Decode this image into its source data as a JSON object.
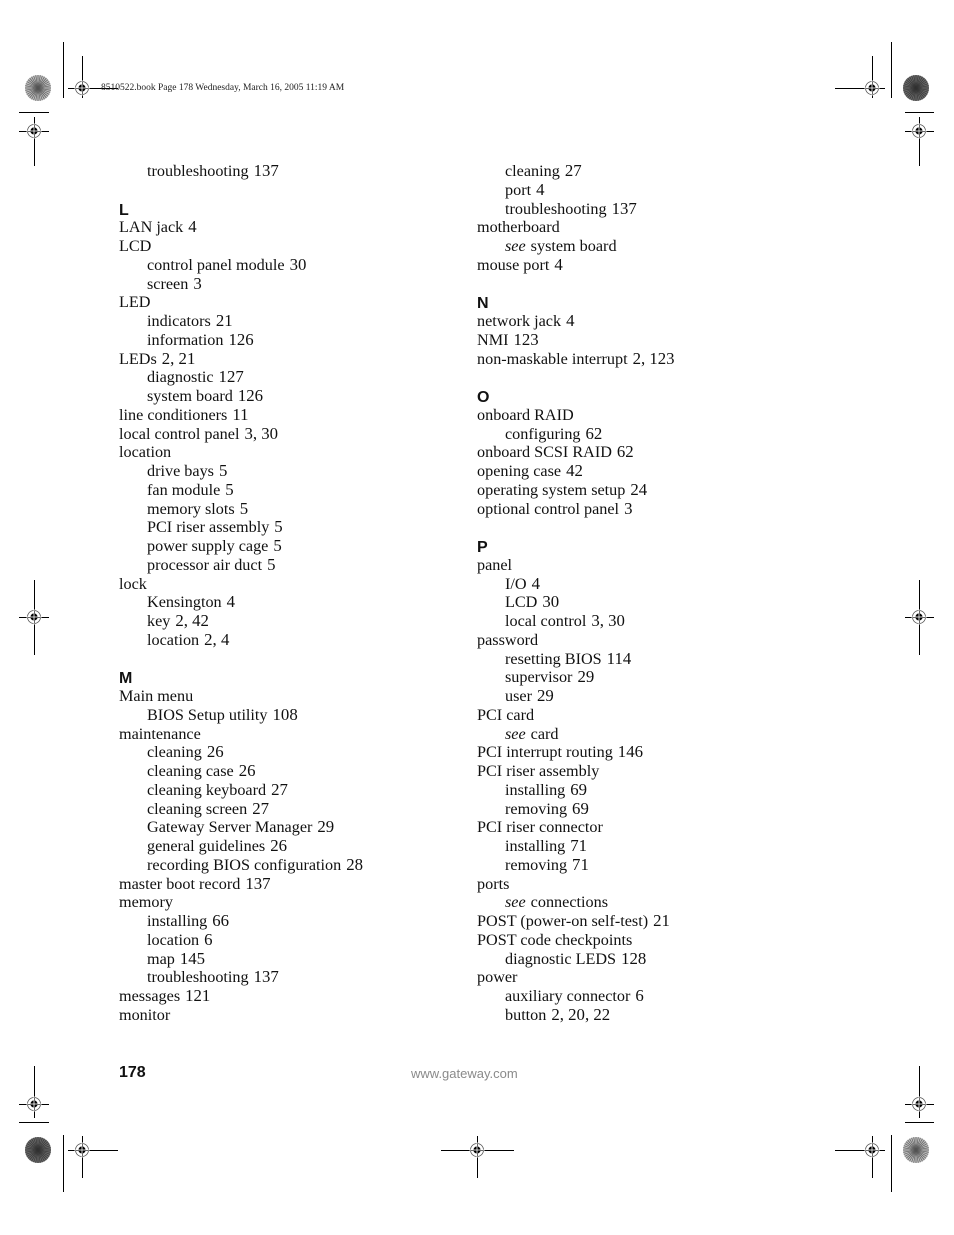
{
  "header": {
    "slug": "8510522.book  Page 178  Wednesday, March 16, 2005  11:19 AM"
  },
  "columns": [
    {
      "entries": [
        {
          "type": "sub",
          "term": "troubleshooting",
          "pages": "137"
        },
        {
          "type": "letter",
          "term": "L"
        },
        {
          "type": "main",
          "term": "LAN jack",
          "pages": "4"
        },
        {
          "type": "main",
          "term": "LCD",
          "pages": ""
        },
        {
          "type": "sub",
          "term": "control panel module",
          "pages": "30"
        },
        {
          "type": "sub",
          "term": "screen",
          "pages": "3"
        },
        {
          "type": "main",
          "term": "LED",
          "pages": ""
        },
        {
          "type": "sub",
          "term": "indicators",
          "pages": "21"
        },
        {
          "type": "sub",
          "term": "information",
          "pages": "126"
        },
        {
          "type": "main",
          "term": "LEDs",
          "pages": "2, 21"
        },
        {
          "type": "sub",
          "term": "diagnostic",
          "pages": "127"
        },
        {
          "type": "sub",
          "term": "system board",
          "pages": "126"
        },
        {
          "type": "main",
          "term": "line conditioners",
          "pages": "11"
        },
        {
          "type": "main",
          "term": "local control panel",
          "pages": "3, 30"
        },
        {
          "type": "main",
          "term": "location",
          "pages": ""
        },
        {
          "type": "sub",
          "term": "drive bays",
          "pages": "5"
        },
        {
          "type": "sub",
          "term": "fan module",
          "pages": "5"
        },
        {
          "type": "sub",
          "term": "memory slots",
          "pages": "5"
        },
        {
          "type": "sub",
          "term": "PCI riser assembly",
          "pages": "5"
        },
        {
          "type": "sub",
          "term": "power supply cage",
          "pages": "5"
        },
        {
          "type": "sub",
          "term": "processor air duct",
          "pages": "5"
        },
        {
          "type": "main",
          "term": "lock",
          "pages": ""
        },
        {
          "type": "sub",
          "term": "Kensington",
          "pages": "4"
        },
        {
          "type": "sub",
          "term": "key",
          "pages": "2, 42"
        },
        {
          "type": "sub",
          "term": "location",
          "pages": "2, 4"
        },
        {
          "type": "letter",
          "term": "M"
        },
        {
          "type": "main",
          "term": "Main menu",
          "pages": ""
        },
        {
          "type": "sub",
          "term": "BIOS Setup utility",
          "pages": "108"
        },
        {
          "type": "main",
          "term": "maintenance",
          "pages": ""
        },
        {
          "type": "sub",
          "term": "cleaning",
          "pages": "26"
        },
        {
          "type": "sub",
          "term": "cleaning case",
          "pages": "26"
        },
        {
          "type": "sub",
          "term": "cleaning keyboard",
          "pages": "27"
        },
        {
          "type": "sub",
          "term": "cleaning screen",
          "pages": "27"
        },
        {
          "type": "sub",
          "term": "Gateway Server Manager",
          "pages": "29"
        },
        {
          "type": "sub",
          "term": "general guidelines",
          "pages": "26"
        },
        {
          "type": "sub",
          "term": "recording BIOS configuration",
          "pages": "28"
        },
        {
          "type": "main",
          "term": "master boot record",
          "pages": "137"
        },
        {
          "type": "main",
          "term": "memory",
          "pages": ""
        },
        {
          "type": "sub",
          "term": "installing",
          "pages": "66"
        },
        {
          "type": "sub",
          "term": "location",
          "pages": "6"
        },
        {
          "type": "sub",
          "term": "map",
          "pages": "145"
        },
        {
          "type": "sub",
          "term": "troubleshooting",
          "pages": "137"
        },
        {
          "type": "main",
          "term": "messages",
          "pages": "121"
        },
        {
          "type": "main",
          "term": "monitor",
          "pages": ""
        }
      ]
    },
    {
      "entries": [
        {
          "type": "sub",
          "term": "cleaning",
          "pages": "27"
        },
        {
          "type": "sub",
          "term": "port",
          "pages": "4"
        },
        {
          "type": "sub",
          "term": "troubleshooting",
          "pages": "137"
        },
        {
          "type": "main",
          "term": "motherboard",
          "pages": ""
        },
        {
          "type": "sub",
          "see": "see",
          "term": "system board",
          "pages": ""
        },
        {
          "type": "main",
          "term": "mouse port",
          "pages": "4"
        },
        {
          "type": "letter",
          "term": "N"
        },
        {
          "type": "main",
          "term": "network jack",
          "pages": "4"
        },
        {
          "type": "main",
          "term": "NMI",
          "pages": "123"
        },
        {
          "type": "main",
          "term": "non-maskable interrupt",
          "pages": "2, 123"
        },
        {
          "type": "letter",
          "term": "O"
        },
        {
          "type": "main",
          "term": "onboard RAID",
          "pages": ""
        },
        {
          "type": "sub",
          "term": "configuring",
          "pages": "62"
        },
        {
          "type": "main",
          "term": "onboard SCSI RAID",
          "pages": "62"
        },
        {
          "type": "main",
          "term": "opening case",
          "pages": "42"
        },
        {
          "type": "main",
          "term": "operating system setup",
          "pages": "24"
        },
        {
          "type": "main",
          "term": "optional control panel",
          "pages": "3"
        },
        {
          "type": "letter",
          "term": "P"
        },
        {
          "type": "main",
          "term": "panel",
          "pages": ""
        },
        {
          "type": "sub",
          "term": "I/O",
          "pages": "4"
        },
        {
          "type": "sub",
          "term": "LCD",
          "pages": "30"
        },
        {
          "type": "sub",
          "term": "local control",
          "pages": "3, 30"
        },
        {
          "type": "main",
          "term": "password",
          "pages": ""
        },
        {
          "type": "sub",
          "term": "resetting BIOS",
          "pages": "114"
        },
        {
          "type": "sub",
          "term": "supervisor",
          "pages": "29"
        },
        {
          "type": "sub",
          "term": "user",
          "pages": "29"
        },
        {
          "type": "main",
          "term": "PCI card",
          "pages": ""
        },
        {
          "type": "sub",
          "see": "see",
          "term": "card",
          "pages": ""
        },
        {
          "type": "main",
          "term": "PCI interrupt routing",
          "pages": "146"
        },
        {
          "type": "main",
          "term": "PCI riser assembly",
          "pages": ""
        },
        {
          "type": "sub",
          "term": "installing",
          "pages": "69"
        },
        {
          "type": "sub",
          "term": "removing",
          "pages": "69"
        },
        {
          "type": "main",
          "term": "PCI riser connector",
          "pages": ""
        },
        {
          "type": "sub",
          "term": "installing",
          "pages": "71"
        },
        {
          "type": "sub",
          "term": "removing",
          "pages": "71"
        },
        {
          "type": "main",
          "term": "ports",
          "pages": ""
        },
        {
          "type": "sub",
          "see": "see",
          "term": "connections",
          "pages": ""
        },
        {
          "type": "main",
          "term": "POST (power-on self-test)",
          "pages": "21"
        },
        {
          "type": "main",
          "term": "POST code checkpoints",
          "pages": ""
        },
        {
          "type": "sub",
          "term": "diagnostic LEDS",
          "pages": "128"
        },
        {
          "type": "main",
          "term": "power",
          "pages": ""
        },
        {
          "type": "sub",
          "term": "auxiliary connector",
          "pages": "6"
        },
        {
          "type": "sub",
          "term": "button",
          "pages": "2, 20, 22"
        }
      ]
    }
  ],
  "footer": {
    "page_number": "178",
    "url": "www.gateway.com"
  },
  "colors": {
    "text": "#111111",
    "url": "#8a8a8a"
  }
}
